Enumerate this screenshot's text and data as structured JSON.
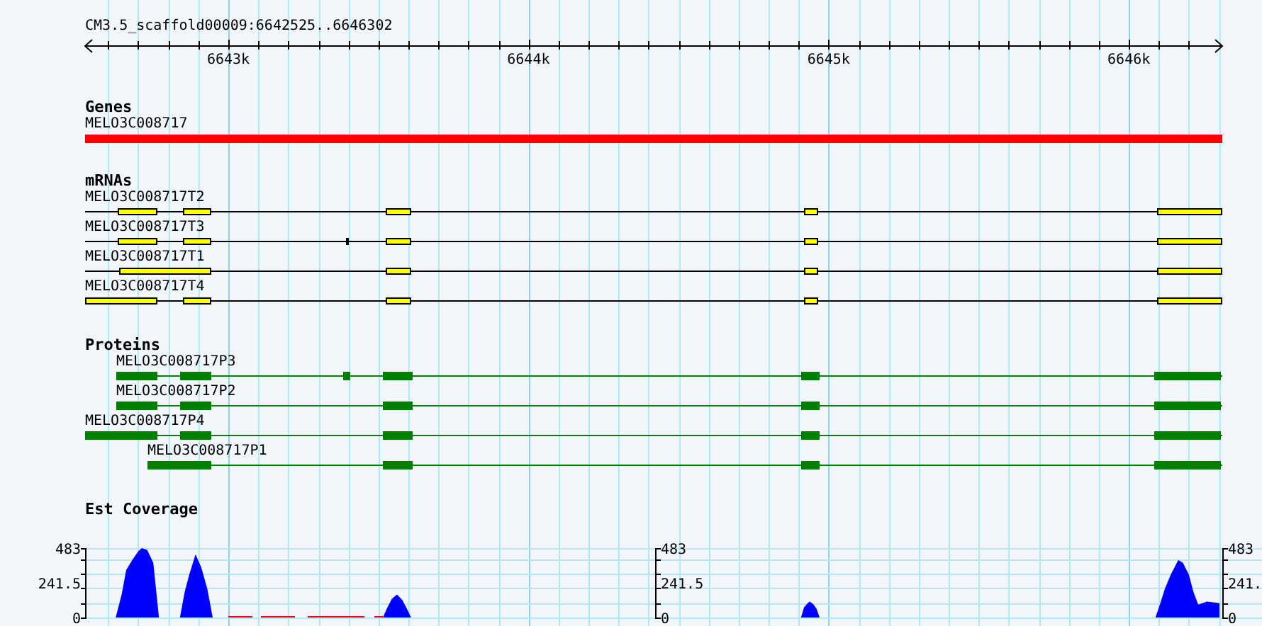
{
  "ruler": {
    "title": "CM3.5_scaffold00009:6642525..6646302",
    "ticks": [
      "6643k",
      "6644k",
      "6645k",
      "6646k"
    ]
  },
  "genes": {
    "title": "Genes",
    "items": [
      {
        "name": "MELO3C008717"
      }
    ]
  },
  "mrnas": {
    "title": "mRNAs",
    "items": [
      {
        "name": "MELO3C008717T2"
      },
      {
        "name": "MELO3C008717T3"
      },
      {
        "name": "MELO3C008717T1"
      },
      {
        "name": "MELO3C008717T4"
      }
    ]
  },
  "proteins": {
    "title": "Proteins",
    "items": [
      {
        "name": "MELO3C008717P3"
      },
      {
        "name": "MELO3C008717P2"
      },
      {
        "name": "MELO3C008717P4"
      },
      {
        "name": "MELO3C008717P1"
      }
    ]
  },
  "coverage": {
    "title": "Est Coverage",
    "axes": [
      {
        "ticks": [
          "483",
          "241.5",
          "0"
        ]
      },
      {
        "ticks": [
          "483",
          "241.5",
          "0"
        ]
      },
      {
        "ticks": [
          "483",
          "241.",
          "0"
        ]
      }
    ]
  }
}
